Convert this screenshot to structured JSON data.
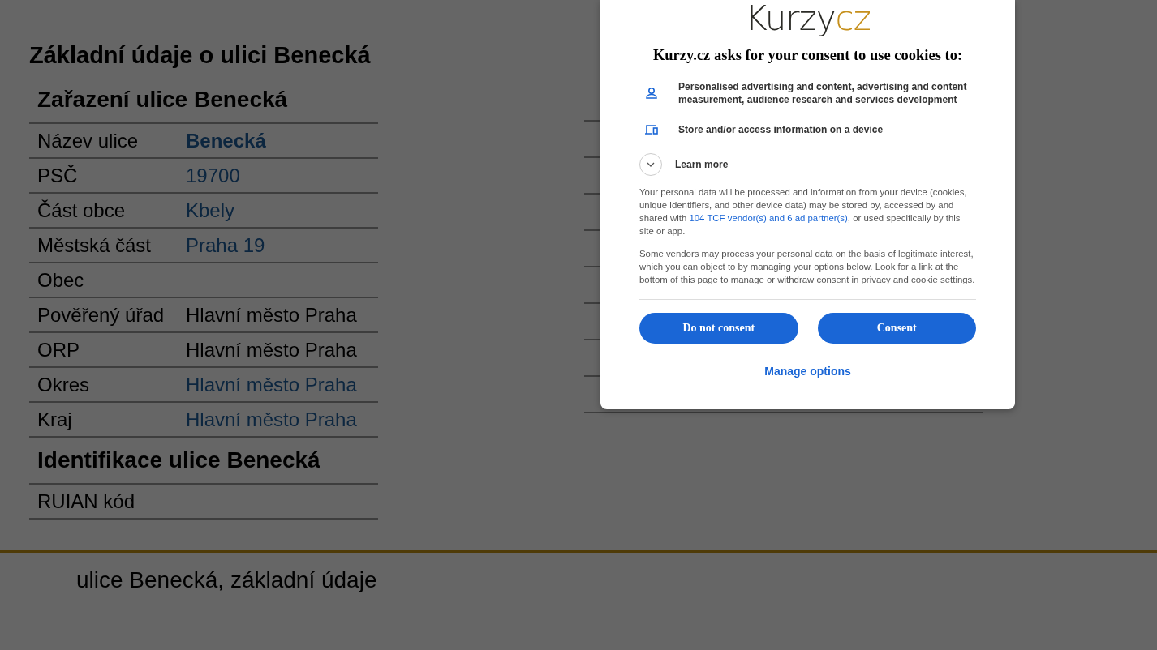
{
  "page": {
    "heading": "Základní údaje o ulici Benecká",
    "sections": [
      {
        "title": "Zařazení ulice Benecká",
        "rows": [
          {
            "label": "Název ulice",
            "value": "Benecká",
            "link": true,
            "bold": true
          },
          {
            "label": "PSČ",
            "value": "19700",
            "link": true,
            "bold": false
          },
          {
            "label": "Část obce",
            "value": "Kbely",
            "link": true,
            "bold": false
          },
          {
            "label": "Městská část",
            "value": "Praha 19",
            "link": true,
            "bold": false
          },
          {
            "label": "Obec"
          },
          {
            "label": "Pověřený úřad",
            "value": "Hlavní město Praha",
            "link": false,
            "bold": false
          },
          {
            "label": "ORP",
            "value": "Hlavní město Praha",
            "link": false,
            "bold": false
          },
          {
            "label": "Okres",
            "value": "Hlavní město Praha",
            "link": true,
            "bold": false
          },
          {
            "label": "Kraj",
            "value": "Hlavní město Praha",
            "link": true,
            "bold": false
          }
        ]
      },
      {
        "title": "Identifikace ulice Benecká",
        "rows": [
          {
            "label": "RUIAN kód"
          }
        ]
      }
    ],
    "footer": "ulice Benecká, základní údaje"
  },
  "consent": {
    "logo": {
      "text": "Kurzy",
      "accent": "cz"
    },
    "title": "Kurzy.cz asks for your consent to use cookies to:",
    "purposes": [
      "Personalised advertising and content, advertising and content measurement, audience research and services development",
      "Store and/or access information on a device"
    ],
    "learn_more": {
      "label": "Learn more",
      "expanded": false
    },
    "paragraphs": [
      {
        "text": "Your personal data will be processed and information from your device (cookies, unique identifiers, and other device data) may be stored by, accessed by and shared with ",
        "link": "104 TCF vendor(s) and 6 ad partner(s)",
        "after": ", or used specifically by this site or app."
      },
      {
        "text": "Some vendors may process your personal data on the basis of legitimate interest, which you can object to by managing your options below. Look for a link at the bottom of this page to manage or withdraw consent in privacy and cookie settings."
      }
    ],
    "buttons": [
      "Do not consent",
      "Consent"
    ],
    "manage": "Manage options"
  }
}
